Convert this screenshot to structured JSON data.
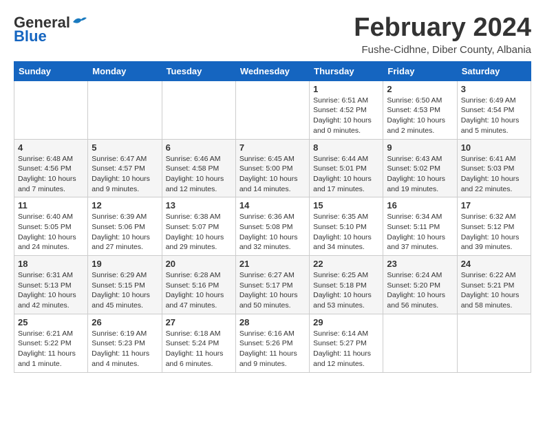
{
  "logo": {
    "text_general": "General",
    "text_blue": "Blue"
  },
  "header": {
    "month_title": "February 2024",
    "location": "Fushe-Cidhne, Diber County, Albania"
  },
  "weekdays": [
    "Sunday",
    "Monday",
    "Tuesday",
    "Wednesday",
    "Thursday",
    "Friday",
    "Saturday"
  ],
  "weeks": [
    [
      {
        "day": "",
        "info": ""
      },
      {
        "day": "",
        "info": ""
      },
      {
        "day": "",
        "info": ""
      },
      {
        "day": "",
        "info": ""
      },
      {
        "day": "1",
        "info": "Sunrise: 6:51 AM\nSunset: 4:52 PM\nDaylight: 10 hours\nand 0 minutes."
      },
      {
        "day": "2",
        "info": "Sunrise: 6:50 AM\nSunset: 4:53 PM\nDaylight: 10 hours\nand 2 minutes."
      },
      {
        "day": "3",
        "info": "Sunrise: 6:49 AM\nSunset: 4:54 PM\nDaylight: 10 hours\nand 5 minutes."
      }
    ],
    [
      {
        "day": "4",
        "info": "Sunrise: 6:48 AM\nSunset: 4:56 PM\nDaylight: 10 hours\nand 7 minutes."
      },
      {
        "day": "5",
        "info": "Sunrise: 6:47 AM\nSunset: 4:57 PM\nDaylight: 10 hours\nand 9 minutes."
      },
      {
        "day": "6",
        "info": "Sunrise: 6:46 AM\nSunset: 4:58 PM\nDaylight: 10 hours\nand 12 minutes."
      },
      {
        "day": "7",
        "info": "Sunrise: 6:45 AM\nSunset: 5:00 PM\nDaylight: 10 hours\nand 14 minutes."
      },
      {
        "day": "8",
        "info": "Sunrise: 6:44 AM\nSunset: 5:01 PM\nDaylight: 10 hours\nand 17 minutes."
      },
      {
        "day": "9",
        "info": "Sunrise: 6:43 AM\nSunset: 5:02 PM\nDaylight: 10 hours\nand 19 minutes."
      },
      {
        "day": "10",
        "info": "Sunrise: 6:41 AM\nSunset: 5:03 PM\nDaylight: 10 hours\nand 22 minutes."
      }
    ],
    [
      {
        "day": "11",
        "info": "Sunrise: 6:40 AM\nSunset: 5:05 PM\nDaylight: 10 hours\nand 24 minutes."
      },
      {
        "day": "12",
        "info": "Sunrise: 6:39 AM\nSunset: 5:06 PM\nDaylight: 10 hours\nand 27 minutes."
      },
      {
        "day": "13",
        "info": "Sunrise: 6:38 AM\nSunset: 5:07 PM\nDaylight: 10 hours\nand 29 minutes."
      },
      {
        "day": "14",
        "info": "Sunrise: 6:36 AM\nSunset: 5:08 PM\nDaylight: 10 hours\nand 32 minutes."
      },
      {
        "day": "15",
        "info": "Sunrise: 6:35 AM\nSunset: 5:10 PM\nDaylight: 10 hours\nand 34 minutes."
      },
      {
        "day": "16",
        "info": "Sunrise: 6:34 AM\nSunset: 5:11 PM\nDaylight: 10 hours\nand 37 minutes."
      },
      {
        "day": "17",
        "info": "Sunrise: 6:32 AM\nSunset: 5:12 PM\nDaylight: 10 hours\nand 39 minutes."
      }
    ],
    [
      {
        "day": "18",
        "info": "Sunrise: 6:31 AM\nSunset: 5:13 PM\nDaylight: 10 hours\nand 42 minutes."
      },
      {
        "day": "19",
        "info": "Sunrise: 6:29 AM\nSunset: 5:15 PM\nDaylight: 10 hours\nand 45 minutes."
      },
      {
        "day": "20",
        "info": "Sunrise: 6:28 AM\nSunset: 5:16 PM\nDaylight: 10 hours\nand 47 minutes."
      },
      {
        "day": "21",
        "info": "Sunrise: 6:27 AM\nSunset: 5:17 PM\nDaylight: 10 hours\nand 50 minutes."
      },
      {
        "day": "22",
        "info": "Sunrise: 6:25 AM\nSunset: 5:18 PM\nDaylight: 10 hours\nand 53 minutes."
      },
      {
        "day": "23",
        "info": "Sunrise: 6:24 AM\nSunset: 5:20 PM\nDaylight: 10 hours\nand 56 minutes."
      },
      {
        "day": "24",
        "info": "Sunrise: 6:22 AM\nSunset: 5:21 PM\nDaylight: 10 hours\nand 58 minutes."
      }
    ],
    [
      {
        "day": "25",
        "info": "Sunrise: 6:21 AM\nSunset: 5:22 PM\nDaylight: 11 hours\nand 1 minute."
      },
      {
        "day": "26",
        "info": "Sunrise: 6:19 AM\nSunset: 5:23 PM\nDaylight: 11 hours\nand 4 minutes."
      },
      {
        "day": "27",
        "info": "Sunrise: 6:18 AM\nSunset: 5:24 PM\nDaylight: 11 hours\nand 6 minutes."
      },
      {
        "day": "28",
        "info": "Sunrise: 6:16 AM\nSunset: 5:26 PM\nDaylight: 11 hours\nand 9 minutes."
      },
      {
        "day": "29",
        "info": "Sunrise: 6:14 AM\nSunset: 5:27 PM\nDaylight: 11 hours\nand 12 minutes."
      },
      {
        "day": "",
        "info": ""
      },
      {
        "day": "",
        "info": ""
      }
    ]
  ]
}
